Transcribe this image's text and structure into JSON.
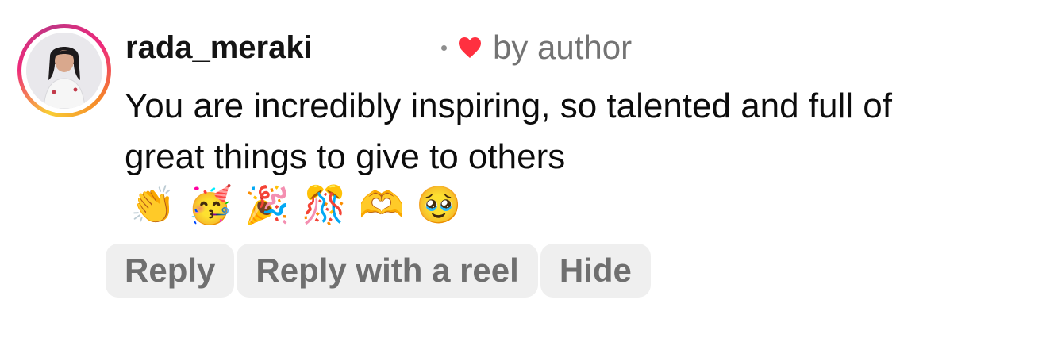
{
  "comment": {
    "username": "rada_meraki",
    "separator": "·",
    "liked_by": "by author",
    "heart_color": "#ff3040",
    "text": "You are incredibly inspiring, so talented and full of great things to give to others",
    "emojis": [
      "👏",
      "🥳",
      "🎉",
      "🎊",
      "🫶",
      "🥹"
    ]
  },
  "actions": {
    "reply_label": "Reply",
    "reply_reel_label": "Reply with a reel",
    "hide_label": "Hide"
  }
}
